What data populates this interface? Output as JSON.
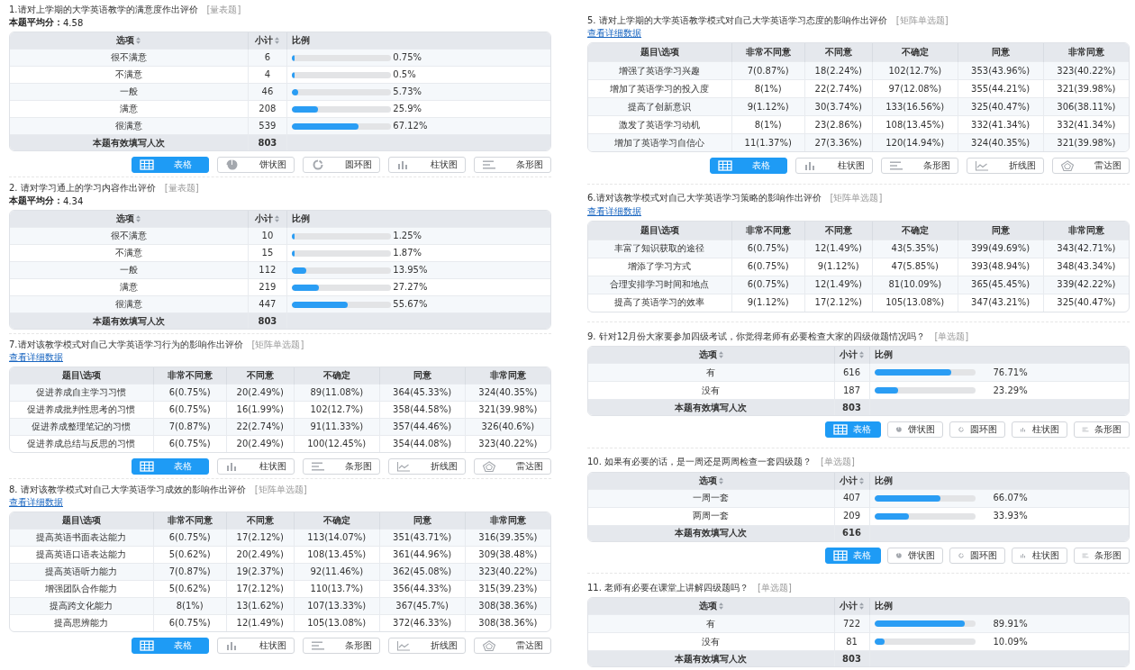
{
  "left": [
    {
      "kind": "rating",
      "title": "1.请对上学期的大学英语教学的满意度作出评价",
      "tag": "[量表题]",
      "average_label": "本题平均分：",
      "average": "4.58",
      "table": {
        "columns": [
          {
            "label": "选项",
            "sortable": true
          },
          {
            "label": "小计",
            "sortable": true
          },
          {
            "label": "比例",
            "sortable": false
          }
        ],
        "rows": [
          {
            "option": "很不满意",
            "count": "6",
            "level": 0.0075,
            "percent": "0.75%"
          },
          {
            "option": "不满意",
            "count": "4",
            "level": 0.005,
            "percent": "0.5%"
          },
          {
            "option": "一般",
            "count": "46",
            "level": 0.0573,
            "percent": "5.73%"
          },
          {
            "option": "满意",
            "count": "208",
            "level": 0.259,
            "percent": "25.9%"
          },
          {
            "option": "很满意",
            "count": "539",
            "level": 0.6712,
            "percent": "67.12%"
          }
        ],
        "footer": {
          "label": "本题有效填写人次",
          "count": "803"
        }
      },
      "view_buttons": [
        {
          "kind": "table",
          "label": "表格",
          "selected": true
        },
        {
          "kind": "pie",
          "label": "饼状图",
          "selected": false
        },
        {
          "kind": "donut",
          "label": "圆环图",
          "selected": false
        },
        {
          "kind": "bar",
          "label": "柱状图",
          "selected": false
        },
        {
          "kind": "hbar",
          "label": "条形图",
          "selected": false
        }
      ]
    },
    {
      "kind": "rating",
      "title": "2. 请对学习通上的学习内容作出评价",
      "tag": "[量表题]",
      "average_label": "本题平均分：",
      "average": "4.34",
      "table": {
        "columns": [
          {
            "label": "选项",
            "sortable": true
          },
          {
            "label": "小计",
            "sortable": true
          },
          {
            "label": "比例",
            "sortable": false
          }
        ],
        "rows": [
          {
            "option": "很不满意",
            "count": "10",
            "level": 0.0125,
            "percent": "1.25%"
          },
          {
            "option": "不满意",
            "count": "15",
            "level": 0.0187,
            "percent": "1.87%"
          },
          {
            "option": "一般",
            "count": "112",
            "level": 0.1395,
            "percent": "13.95%"
          },
          {
            "option": "满意",
            "count": "219",
            "level": 0.2727,
            "percent": "27.27%"
          },
          {
            "option": "很满意",
            "count": "447",
            "level": 0.5567,
            "percent": "55.67%"
          }
        ],
        "footer": {
          "label": "本题有效填写人次",
          "count": "803"
        }
      }
    },
    {
      "kind": "matrix",
      "title": "7.请对该教学模式对自己大学英语学习行为的影响作出评价",
      "tag": "[矩阵单选题]",
      "detail_link": "查看详细数据",
      "table": {
        "row_header": "题目\\选项",
        "columns": [
          "非常不同意",
          "不同意",
          "不确定",
          "同意",
          "非常同意"
        ],
        "rows": [
          {
            "label": "促进养成自主学习习惯",
            "cells": [
              "6(0.75%)",
              "20(2.49%)",
              "89(11.08%)",
              "364(45.33%)",
              "324(40.35%)"
            ]
          },
          {
            "label": "促进养成批判性思考的习惯",
            "cells": [
              "6(0.75%)",
              "16(1.99%)",
              "102(12.7%)",
              "358(44.58%)",
              "321(39.98%)"
            ]
          },
          {
            "label": "促进养成整理笔记的习惯",
            "cells": [
              "7(0.87%)",
              "22(2.74%)",
              "91(11.33%)",
              "357(44.46%)",
              "326(40.6%)"
            ]
          },
          {
            "label": "促进养成总结与反思的习惯",
            "cells": [
              "6(0.75%)",
              "20(2.49%)",
              "100(12.45%)",
              "354(44.08%)",
              "323(40.22%)"
            ]
          }
        ]
      },
      "view_buttons": [
        {
          "kind": "table",
          "label": "表格",
          "selected": true
        },
        {
          "kind": "bar",
          "label": "柱状图",
          "selected": false
        },
        {
          "kind": "hbar",
          "label": "条形图",
          "selected": false
        },
        {
          "kind": "line",
          "label": "折线图",
          "selected": false
        },
        {
          "kind": "radar",
          "label": "雷达图",
          "selected": false
        }
      ]
    },
    {
      "kind": "matrix",
      "title": "8. 请对该教学模式对自己大学英语学习成效的影响作出评价",
      "tag": "[矩阵单选题]",
      "detail_link": "查看详细数据",
      "table": {
        "row_header": "题目\\选项",
        "columns": [
          "非常不同意",
          "不同意",
          "不确定",
          "同意",
          "非常同意"
        ],
        "rows": [
          {
            "label": "提高英语书面表达能力",
            "cells": [
              "6(0.75%)",
              "17(2.12%)",
              "113(14.07%)",
              "351(43.71%)",
              "316(39.35%)"
            ]
          },
          {
            "label": "提高英语口语表达能力",
            "cells": [
              "5(0.62%)",
              "20(2.49%)",
              "108(13.45%)",
              "361(44.96%)",
              "309(38.48%)"
            ]
          },
          {
            "label": "提高英语听力能力",
            "cells": [
              "7(0.87%)",
              "19(2.37%)",
              "92(11.46%)",
              "362(45.08%)",
              "323(40.22%)"
            ]
          },
          {
            "label": "增强团队合作能力",
            "cells": [
              "5(0.62%)",
              "17(2.12%)",
              "110(13.7%)",
              "356(44.33%)",
              "315(39.23%)"
            ]
          },
          {
            "label": "提高跨文化能力",
            "cells": [
              "8(1%)",
              "13(1.62%)",
              "107(13.33%)",
              "367(45.7%)",
              "308(38.36%)"
            ]
          },
          {
            "label": "提高思辨能力",
            "cells": [
              "6(0.75%)",
              "12(1.49%)",
              "105(13.08%)",
              "372(46.33%)",
              "308(38.36%)"
            ]
          }
        ]
      },
      "view_buttons": [
        {
          "kind": "table",
          "label": "表格",
          "selected": true
        },
        {
          "kind": "bar",
          "label": "柱状图",
          "selected": false
        },
        {
          "kind": "hbar",
          "label": "条形图",
          "selected": false
        },
        {
          "kind": "line",
          "label": "折线图",
          "selected": false
        },
        {
          "kind": "radar",
          "label": "雷达图",
          "selected": false
        }
      ]
    }
  ],
  "right": [
    {
      "kind": "matrix",
      "title": "5. 请对上学期的大学英语教学模式对自己大学英语学习态度的影响作出评价",
      "tag": "[矩阵单选题]",
      "detail_link": "查看详细数据",
      "table": {
        "row_header": "题目\\选项",
        "columns": [
          "非常不同意",
          "不同意",
          "不确定",
          "同意",
          "非常同意"
        ],
        "rows": [
          {
            "label": "增强了英语学习兴趣",
            "cells": [
              "7(0.87%)",
              "18(2.24%)",
              "102(12.7%)",
              "353(43.96%)",
              "323(40.22%)"
            ]
          },
          {
            "label": "增加了英语学习的投入度",
            "cells": [
              "8(1%)",
              "22(2.74%)",
              "97(12.08%)",
              "355(44.21%)",
              "321(39.98%)"
            ]
          },
          {
            "label": "提高了创新意识",
            "cells": [
              "9(1.12%)",
              "30(3.74%)",
              "133(16.56%)",
              "325(40.47%)",
              "306(38.11%)"
            ]
          },
          {
            "label": "激发了英语学习动机",
            "cells": [
              "8(1%)",
              "23(2.86%)",
              "108(13.45%)",
              "332(41.34%)",
              "332(41.34%)"
            ]
          },
          {
            "label": "增加了英语学习自信心",
            "cells": [
              "11(1.37%)",
              "27(3.36%)",
              "120(14.94%)",
              "324(40.35%)",
              "321(39.98%)"
            ]
          }
        ]
      },
      "view_buttons": [
        {
          "kind": "table",
          "label": "表格",
          "selected": true
        },
        {
          "kind": "bar",
          "label": "柱状图",
          "selected": false
        },
        {
          "kind": "hbar",
          "label": "条形图",
          "selected": false
        },
        {
          "kind": "line",
          "label": "折线图",
          "selected": false
        },
        {
          "kind": "radar",
          "label": "雷达图",
          "selected": false
        }
      ]
    },
    {
      "kind": "matrix",
      "title": "6.请对该教学模式对自己大学英语学习策略的影响作出评价",
      "tag": "[矩阵单选题]",
      "detail_link": "查看详细数据",
      "table": {
        "row_header": "题目\\选项",
        "columns": [
          "非常不同意",
          "不同意",
          "不确定",
          "同意",
          "非常同意"
        ],
        "rows": [
          {
            "label": "丰富了知识获取的途径",
            "cells": [
              "6(0.75%)",
              "12(1.49%)",
              "43(5.35%)",
              "399(49.69%)",
              "343(42.71%)"
            ]
          },
          {
            "label": "增添了学习方式",
            "cells": [
              "6(0.75%)",
              "9(1.12%)",
              "47(5.85%)",
              "393(48.94%)",
              "348(43.34%)"
            ]
          },
          {
            "label": "合理安排学习时间和地点",
            "cells": [
              "6(0.75%)",
              "12(1.49%)",
              "81(10.09%)",
              "365(45.45%)",
              "339(42.22%)"
            ]
          },
          {
            "label": "提高了英语学习的效率",
            "cells": [
              "9(1.12%)",
              "17(2.12%)",
              "105(13.08%)",
              "347(43.21%)",
              "325(40.47%)"
            ]
          }
        ]
      }
    },
    {
      "kind": "single",
      "title": "9. 针对12月份大家要参加四级考试，你觉得老师有必要检查大家的四级做题情况吗？",
      "tag": "[单选题]",
      "table": {
        "columns": [
          {
            "label": "选项",
            "sortable": true
          },
          {
            "label": "小计",
            "sortable": true
          },
          {
            "label": "比例",
            "sortable": false
          }
        ],
        "rows": [
          {
            "option": "有",
            "count": "616",
            "level": 0.7671,
            "percent": "76.71%"
          },
          {
            "option": "没有",
            "count": "187",
            "level": 0.2329,
            "percent": "23.29%"
          }
        ],
        "footer": {
          "label": "本题有效填写人次",
          "count": "803"
        }
      },
      "view_buttons": [
        {
          "kind": "table",
          "label": "表格",
          "selected": true
        },
        {
          "kind": "pie",
          "label": "饼状图",
          "selected": false
        },
        {
          "kind": "donut",
          "label": "圆环图",
          "selected": false
        },
        {
          "kind": "bar",
          "label": "柱状图",
          "selected": false
        },
        {
          "kind": "hbar",
          "label": "条形图",
          "selected": false
        }
      ]
    },
    {
      "kind": "single",
      "title": "10. 如果有必要的话，是一周还是两周检查一套四级题？",
      "tag": "[单选题]",
      "table": {
        "columns": [
          {
            "label": "选项",
            "sortable": true
          },
          {
            "label": "小计",
            "sortable": true
          },
          {
            "label": "比例",
            "sortable": false
          }
        ],
        "rows": [
          {
            "option": "一周一套",
            "count": "407",
            "level": 0.6607,
            "percent": "66.07%"
          },
          {
            "option": "两周一套",
            "count": "209",
            "level": 0.3393,
            "percent": "33.93%"
          }
        ],
        "footer": {
          "label": "本题有效填写人次",
          "count": "616"
        }
      },
      "view_buttons": [
        {
          "kind": "table",
          "label": "表格",
          "selected": true
        },
        {
          "kind": "pie",
          "label": "饼状图",
          "selected": false
        },
        {
          "kind": "donut",
          "label": "圆环图",
          "selected": false
        },
        {
          "kind": "bar",
          "label": "柱状图",
          "selected": false
        },
        {
          "kind": "hbar",
          "label": "条形图",
          "selected": false
        }
      ]
    },
    {
      "kind": "single",
      "title": "11. 老师有必要在课堂上讲解四级题吗？",
      "tag": "[单选题]",
      "table": {
        "columns": [
          {
            "label": "选项",
            "sortable": true
          },
          {
            "label": "小计",
            "sortable": true
          },
          {
            "label": "比例",
            "sortable": false
          }
        ],
        "rows": [
          {
            "option": "有",
            "count": "722",
            "level": 0.8991,
            "percent": "89.91%"
          },
          {
            "option": "没有",
            "count": "81",
            "level": 0.1009,
            "percent": "10.09%"
          }
        ],
        "footer": {
          "label": "本题有效填写人次",
          "count": "803"
        }
      }
    }
  ]
}
